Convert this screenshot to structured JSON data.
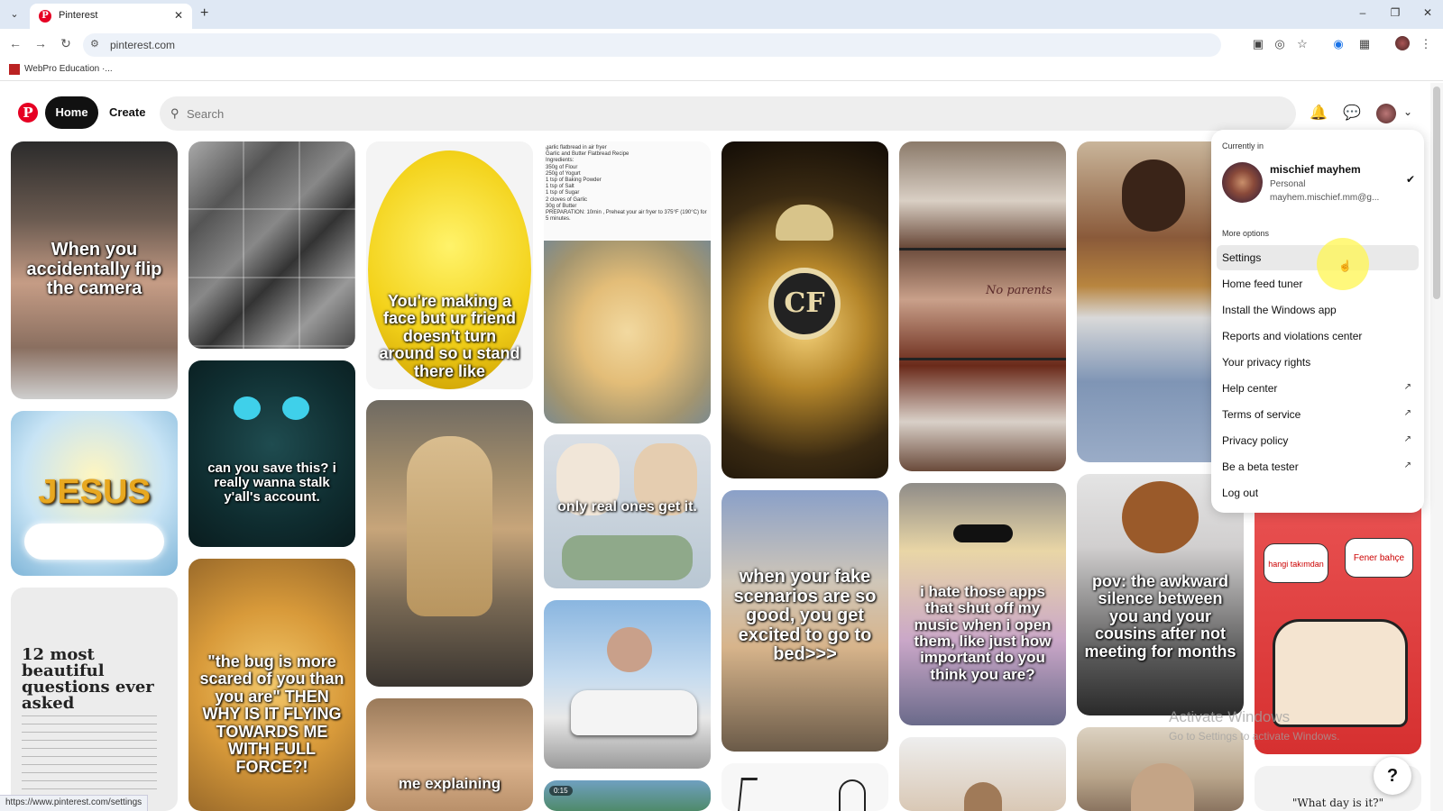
{
  "browser": {
    "tab_title": "Pinterest",
    "url": "pinterest.com",
    "bookmark_label": "WebPro Education ·..."
  },
  "header": {
    "home_label": "Home",
    "create_label": "Create",
    "search_placeholder": "Search"
  },
  "pins": {
    "p1": "When you accidentally flip the camera",
    "p2": "can you save this? i really wanna stalk y'all's account.",
    "p3": "You're making a face but ur friend doesn't turn around so u stand there like",
    "p4": "only real ones get it.",
    "p5": "when your fake scenarios are so good, you get excited to go to bed>>>",
    "p6": "i hate those apps that shut off my music when i open them, like just how important do you think you are?",
    "p7": "pov: the awkward silence between you and your cousins after not meeting for months",
    "p8": "\"the bug is more scared of you than you are\" THEN WHY IS IT FLYING TOWARDS ME WITH FULL FORCE?!",
    "p9": "12 most beautiful questions ever asked",
    "p10": "me explaining",
    "p11": "JESUS",
    "p12": "\"What day is it?\"",
    "p13": "hangi takımdan",
    "p14": "Fener bahçe",
    "p15": "No parents",
    "recipe_lines": [
      "garlic flatbread in air fryer",
      "Garlic and Butter Flatbread Recipe",
      "Ingredients:",
      "350g of Flour",
      "250g of Yogurt",
      "1 tsp of Baking Powder",
      "1 tsp of Salt",
      "1 tsp of Sugar",
      "2 cloves of Garlic",
      "30g of Butter",
      "PREPARATION: 10min , Preheat your air fryer to 375°F (190°C) for 5 minutes."
    ],
    "video_duration": "0:15"
  },
  "menu": {
    "currently_in": "Currently in",
    "account_name": "mischief mayhem",
    "account_type": "Personal",
    "account_email": "mayhem.mischief.mm@g...",
    "more_options": "More options",
    "items": [
      {
        "label": "Settings"
      },
      {
        "label": "Home feed tuner"
      },
      {
        "label": "Install the Windows app"
      },
      {
        "label": "Reports and violations center"
      },
      {
        "label": "Your privacy rights"
      },
      {
        "label": "Help center"
      },
      {
        "label": "Terms of service"
      },
      {
        "label": "Privacy policy"
      },
      {
        "label": "Be a beta tester"
      },
      {
        "label": "Log out"
      }
    ]
  },
  "status_url": "https://www.pinterest.com/settings",
  "watermark": {
    "title": "Activate Windows",
    "subtitle": "Go to Settings to activate Windows."
  },
  "help_label": "?",
  "colors": {
    "brand_red": "#e60023",
    "home_pill": "#111111",
    "search_bg": "#efefef"
  }
}
